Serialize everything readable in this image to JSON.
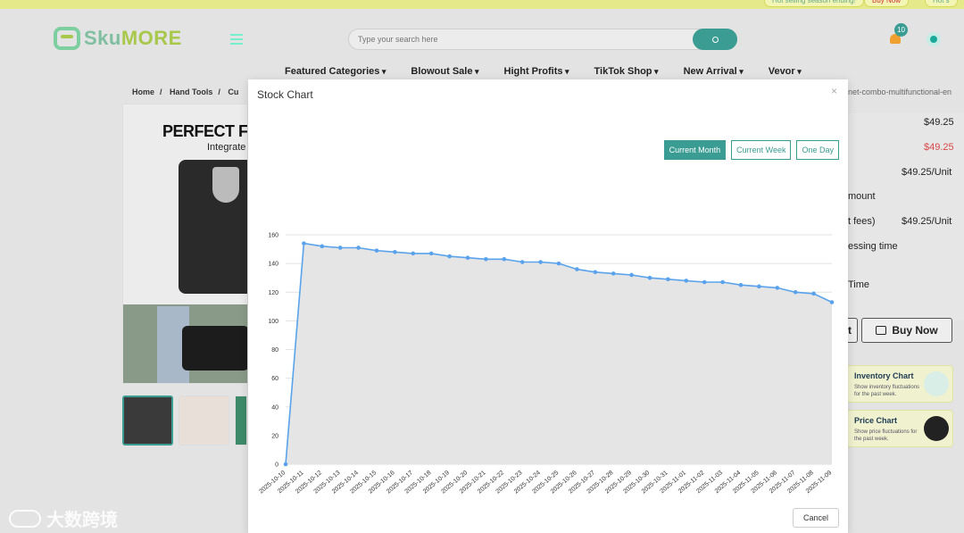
{
  "topbar": {
    "promo_left": "Hot selling season ending!",
    "promo_mid": "Buy Now",
    "promo_right": "Hot s"
  },
  "header": {
    "logo_a": "Sku",
    "logo_b": "MORE",
    "search_placeholder": "Type your search here",
    "notification_count": "10"
  },
  "nav": [
    "Featured Categories",
    "Blowout Sale",
    "Hight Profits",
    "TikTok Shop",
    "New Arrival",
    "Vevor"
  ],
  "breadcrumb": [
    "Home",
    "Hand Tools",
    "Cu"
  ],
  "url_tail": "net-combo-multifunctional-en",
  "product": {
    "headline": "PERFECT FOR",
    "sub": "Integrate"
  },
  "info": {
    "price_1": "$49.25",
    "price_2": "$49.25",
    "price_unit_1": "$49.25/Unit",
    "label_amount": "mount",
    "label_fees": "t fees)",
    "price_unit_2": "$49.25/Unit",
    "label_processing": "essing time",
    "label_time": "Time",
    "add_cart_tail": "t",
    "buy_now": "Buy Now"
  },
  "cards": [
    {
      "title": "Inventory Chart",
      "desc": "Show inventory fluctuations for the past week."
    },
    {
      "title": "Price Chart",
      "desc": "Show price fluctuations for the past week."
    }
  ],
  "watermark": "大数跨境",
  "modal": {
    "title": "Stock Chart",
    "close": "×",
    "tabs": [
      {
        "label": "Current Month",
        "active": true
      },
      {
        "label": "Current Week",
        "active": false
      },
      {
        "label": "One Day",
        "active": false
      }
    ],
    "cancel": "Cancel"
  },
  "chart_data": {
    "type": "area",
    "x": [
      "2025-10-10",
      "2025-10-11",
      "2025-10-12",
      "2025-10-13",
      "2025-10-14",
      "2025-10-15",
      "2025-10-16",
      "2025-10-17",
      "2025-10-18",
      "2025-10-19",
      "2025-10-20",
      "2025-10-21",
      "2025-10-22",
      "2025-10-23",
      "2025-10-24",
      "2025-10-25",
      "2025-10-26",
      "2025-10-27",
      "2025-10-28",
      "2025-10-29",
      "2025-10-30",
      "2025-10-31",
      "2025-11-01",
      "2025-11-02",
      "2025-11-03",
      "2025-11-04",
      "2025-11-05",
      "2025-11-06",
      "2025-11-07",
      "2025-11-08",
      "2025-11-09"
    ],
    "values": [
      0,
      154,
      152,
      151,
      151,
      149,
      148,
      147,
      147,
      145,
      144,
      143,
      143,
      141,
      141,
      140,
      136,
      134,
      133,
      132,
      130,
      129,
      128,
      127,
      127,
      125,
      124,
      123,
      120,
      119,
      113
    ],
    "yticks": [
      0,
      20,
      40,
      60,
      80,
      100,
      120,
      140,
      160
    ],
    "ylim": [
      0,
      160
    ],
    "grid": true,
    "line_color": "#5aa3ec",
    "fill_color": "#e5e5e5"
  }
}
